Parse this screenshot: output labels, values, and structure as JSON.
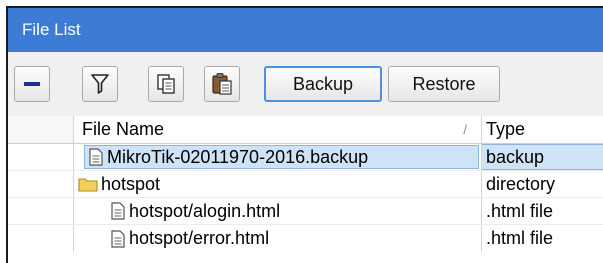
{
  "window": {
    "title": "File List"
  },
  "toolbar": {
    "backup_label": "Backup",
    "restore_label": "Restore",
    "icons": [
      "minus-icon",
      "filter-icon",
      "copy-icon",
      "paste-icon"
    ]
  },
  "table": {
    "columns": {
      "name": "File Name",
      "type": "Type"
    },
    "rows": [
      {
        "name": "MikroTik-02011970-2016.backup",
        "type": "backup",
        "kind": "file",
        "selected": true
      },
      {
        "name": "hotspot",
        "type": "directory",
        "kind": "folder"
      },
      {
        "name": "hotspot/alogin.html",
        "type": ".html file",
        "kind": "file"
      },
      {
        "name": "hotspot/error.html",
        "type": ".html file",
        "kind": "file"
      }
    ]
  },
  "colors": {
    "titlebar": "#3d7cd6",
    "selection": "#cfe3f7",
    "folder": "#f2cf5b"
  }
}
